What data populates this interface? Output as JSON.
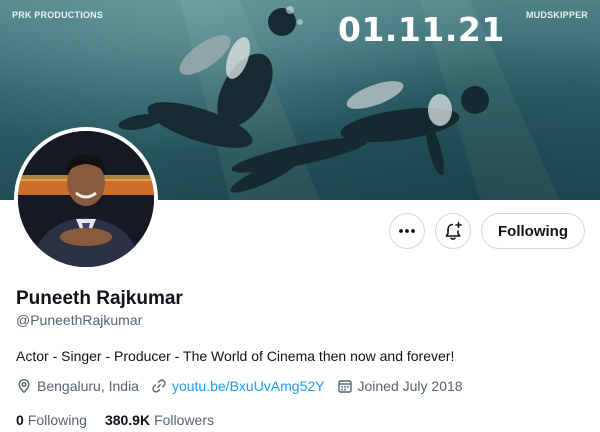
{
  "banner": {
    "credit_left": "PRK PRODUCTIONS",
    "date": "01.11.21",
    "credit_right": "MUDSKIPPER"
  },
  "actions": {
    "more_label": "•••",
    "notify_icon": "bell-plus-icon",
    "follow_label": "Following"
  },
  "profile": {
    "name": "Puneeth Rajkumar",
    "handle": "@PuneethRajkumar",
    "bio": "Actor - Singer - Producer - The World of Cinema then now and forever!",
    "location": "Bengaluru, India",
    "website": "youtu.be/BxuUvAmg52Y",
    "joined": "Joined July 2018",
    "following_count": "0",
    "following_label": "Following",
    "followers_count": "380.9K",
    "followers_label": "Followers"
  },
  "colors": {
    "link": "#1d9bf0",
    "text_primary": "#0f1419",
    "text_secondary": "#536471",
    "border": "#cfd9de"
  },
  "icons": [
    "location-pin-icon",
    "link-icon",
    "calendar-icon",
    "bell-plus-icon",
    "more-icon"
  ]
}
